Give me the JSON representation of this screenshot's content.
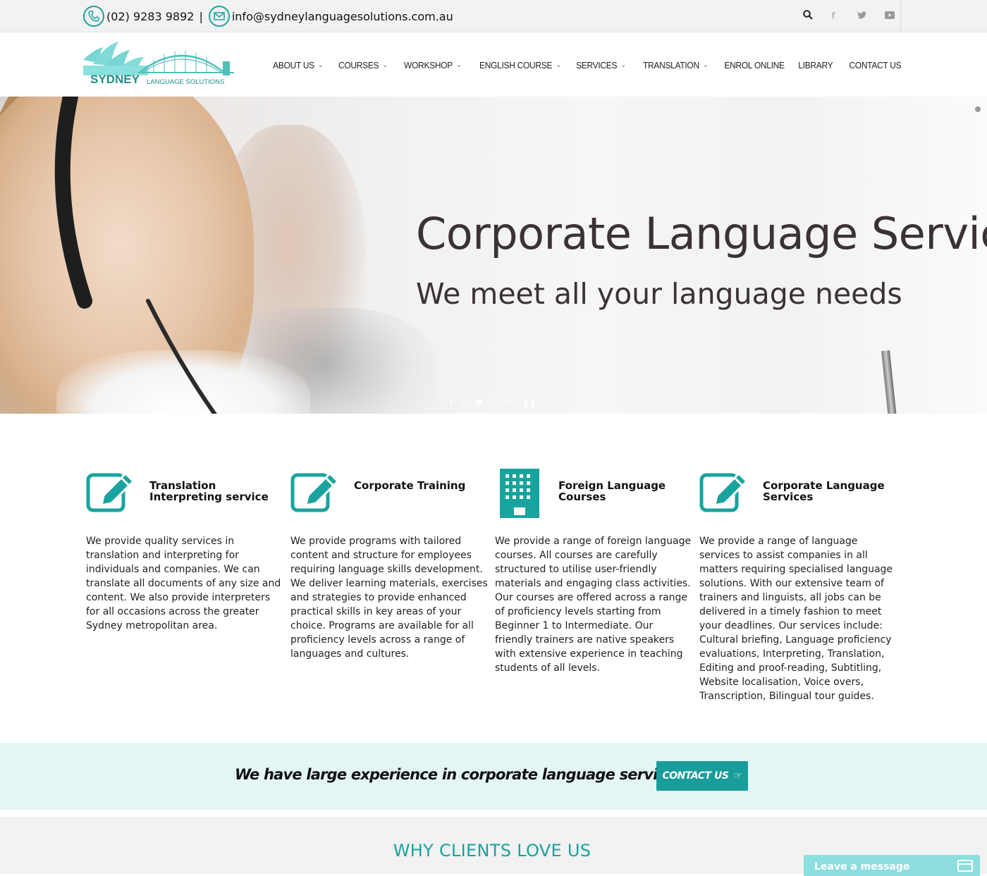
{
  "topbar": {
    "phone": "(02) 9283 9892",
    "separator": "|",
    "email": "info@sydneylanguagesolutions.com.au",
    "icons": [
      "phone-icon",
      "mail-icon",
      "search-icon",
      "facebook-icon",
      "twitter-icon",
      "youtube-icon"
    ]
  },
  "logo": {
    "name": "SYDNEY",
    "tagline": "LANGUAGE SOLUTIONS"
  },
  "nav": {
    "items": [
      {
        "label": "ABOUT US",
        "has_dropdown": true
      },
      {
        "label": "COURSES",
        "has_dropdown": true
      },
      {
        "label": "WORKSHOP",
        "has_dropdown": true
      },
      {
        "label": "ENGLISH COURSE",
        "has_dropdown": true
      },
      {
        "label": "SERVICES",
        "has_dropdown": true
      },
      {
        "label": "TRANSLATION",
        "has_dropdown": true
      },
      {
        "label": "ENROL ONLINE",
        "has_dropdown": false
      },
      {
        "label": "LIBRARY",
        "has_dropdown": false
      },
      {
        "label": "CONTACT US",
        "has_dropdown": false
      }
    ]
  },
  "hero": {
    "title": "Corporate Language Services",
    "subtitle": "We meet all your language needs",
    "slides_count": 4,
    "active_slide": 2
  },
  "features": [
    {
      "icon": "pencil-square-icon",
      "title": "Translation Interpreting service",
      "body": "We provide quality services in translation and interpreting for individuals and companies. We can translate all documents of any size and content. We also provide interpreters for all occasions across the greater Sydney metropolitan area."
    },
    {
      "icon": "pencil-square-icon",
      "title": "Corporate Training",
      "body": "We provide programs with tailored content and structure for employees requiring language skills development. We deliver learning materials, exercises and strategies to provide enhanced practical skills in key areas of your choice. Programs are available for all proficiency levels across a range of languages and cultures."
    },
    {
      "icon": "building-icon",
      "title": "Foreign Language Courses",
      "body": "We provide a range of foreign language courses. All courses are carefully structured to utilise user-friendly materials and engaging class activities. Our courses are offered across a range of proficiency levels starting from Beginner 1 to Intermediate. Our friendly trainers are native speakers with extensive experience in teaching students of all levels."
    },
    {
      "icon": "pencil-square-icon",
      "title": "Corporate Language Services",
      "body": "We provide a range of language services to assist companies in all matters requiring specialised language solutions. With our extensive team of trainers and linguists, all jobs can be delivered in a timely fashion to meet your deadlines. Our services include: Cultural briefing, Language proficiency evaluations, Interpreting, Translation, Editing and proof-reading, Subtitling, Website localisation, Voice overs, Transcription, Bilingual tour guides."
    }
  ],
  "cta": {
    "text": "We have large experience in corporate language service needs",
    "button": "CONTACT US"
  },
  "why": {
    "title": "WHY CLIENTS LOVE US"
  },
  "chat": {
    "label": "Leave a message"
  },
  "colors": {
    "accent": "#19a39e",
    "cta_bg": "#e4f5f5",
    "button": "#189d9a",
    "chat": "#8ddede"
  }
}
